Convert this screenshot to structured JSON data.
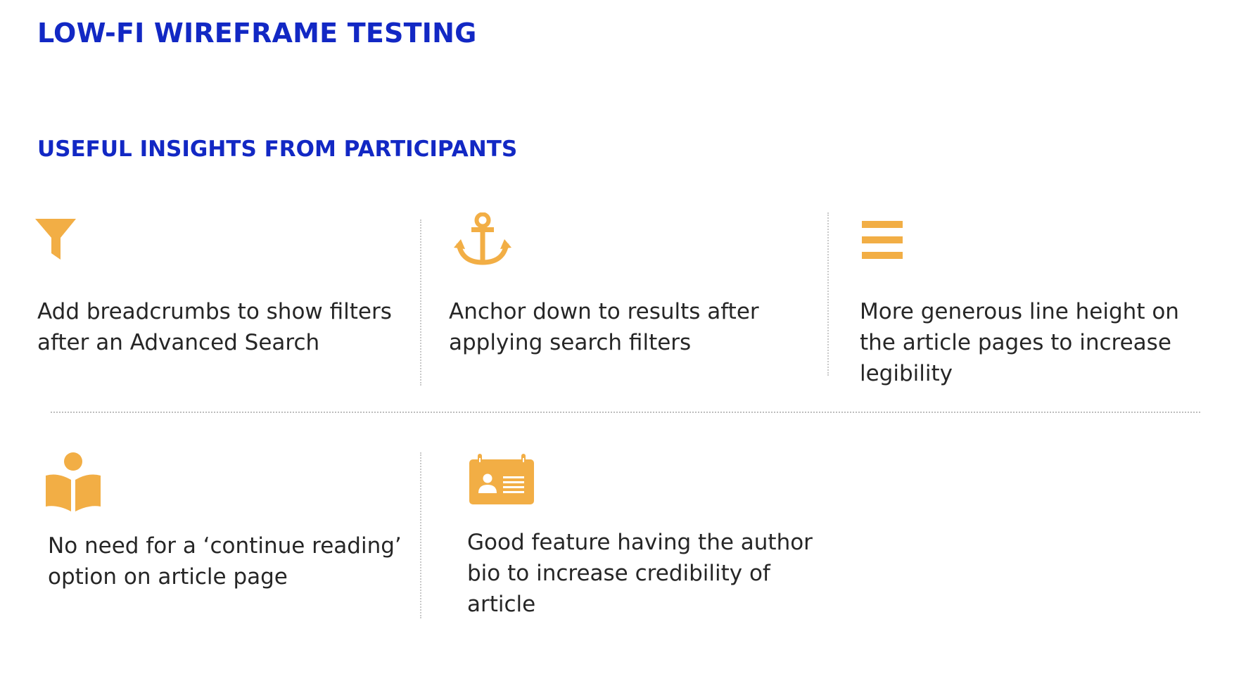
{
  "header": {
    "title": "LOW-FI WIREFRAME TESTING",
    "subtitle": "USEFUL INSIGHTS FROM PARTICIPANTS"
  },
  "colors": {
    "title": "#1228c4",
    "icon": "#f2ae45",
    "text": "#262626",
    "divider": "#c9c9c9"
  },
  "insights": [
    {
      "icon": "filter-icon",
      "text": "Add breadcrumbs to show filters after an Advanced Search"
    },
    {
      "icon": "anchor-icon",
      "text": "Anchor down to results after applying search filters"
    },
    {
      "icon": "menu-lines-icon",
      "text": "More generous line height on the article pages to increase legibility"
    },
    {
      "icon": "reader-book-icon",
      "text": "No need for a ‘continue reading’ option on article page"
    },
    {
      "icon": "id-card-icon",
      "text": "Good feature having the author bio to increase credibility of article"
    }
  ]
}
